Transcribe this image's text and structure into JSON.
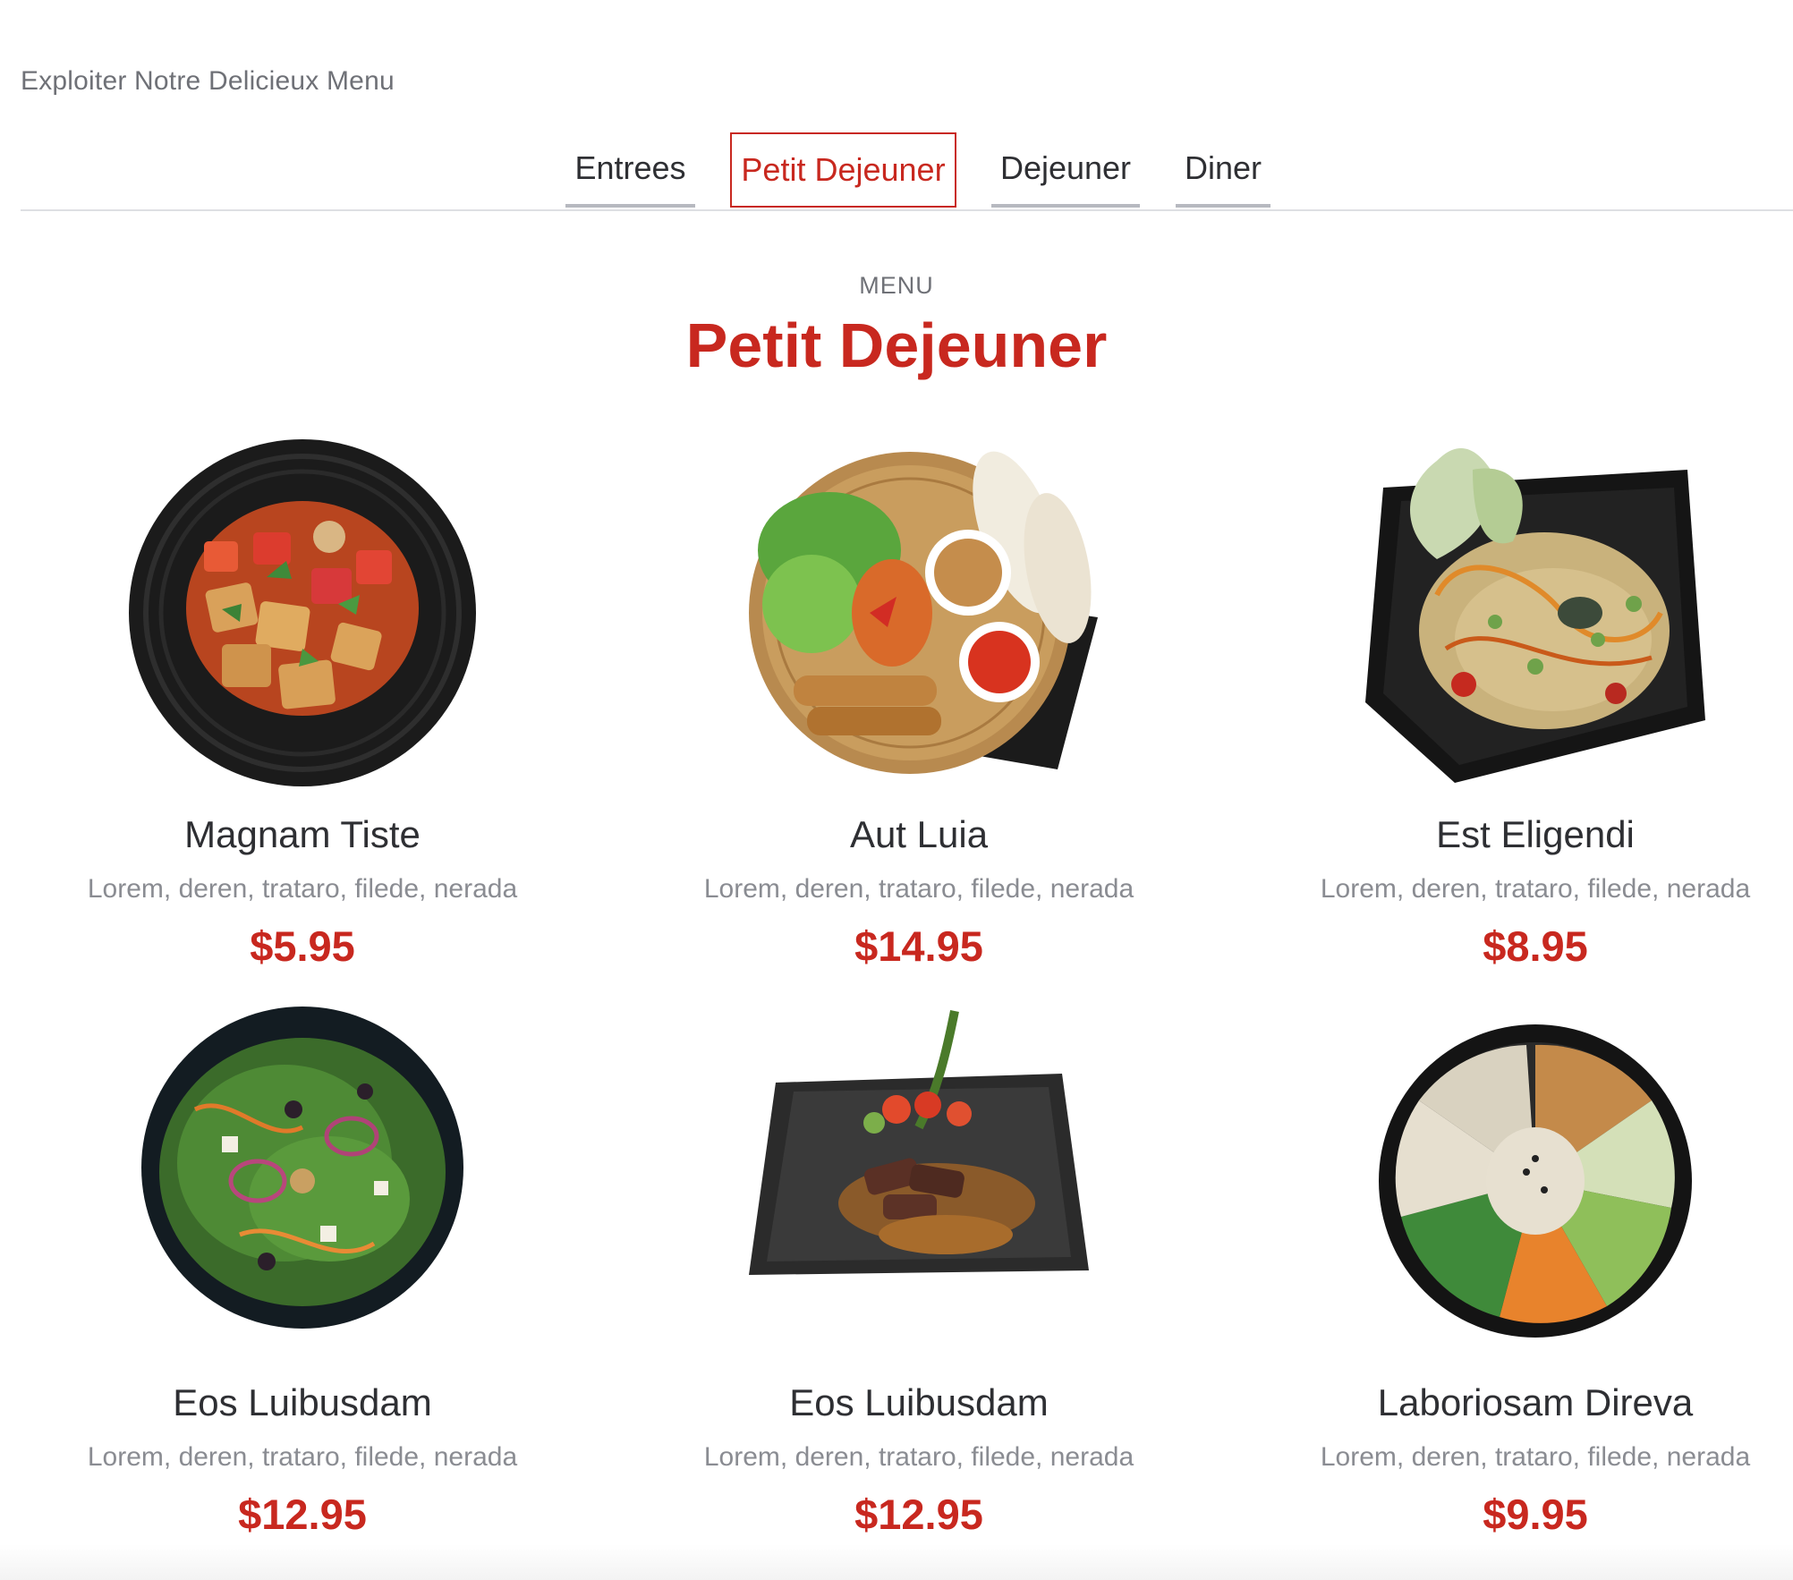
{
  "header": {
    "subtitle": "Exploiter Notre Delicieux Menu"
  },
  "tabs": [
    {
      "label": "Entrees",
      "active": false
    },
    {
      "label": "Petit Dejeuner",
      "active": true
    },
    {
      "label": "Dejeuner",
      "active": false
    },
    {
      "label": "Diner",
      "active": false
    }
  ],
  "section": {
    "eyebrow": "MENU",
    "title": "Petit Dejeuner"
  },
  "items": [
    {
      "name": "Magnam Tiste",
      "description": "Lorem, deren, trataro, filede, nerada",
      "price": "$5.95",
      "image": "tofu-bowl"
    },
    {
      "name": "Aut Luia",
      "description": "Lorem, deren, trataro, filede, nerada",
      "price": "$14.95",
      "image": "spring-roll-basket"
    },
    {
      "name": "Est Eligendi",
      "description": "Lorem, deren, trataro, filede, nerada",
      "price": "$8.95",
      "image": "papaya-salad-plate"
    },
    {
      "name": "Eos Luibusdam",
      "description": "Lorem, deren, trataro, filede, nerada",
      "price": "$12.95",
      "image": "green-salad-bowl"
    },
    {
      "name": "Eos Luibusdam",
      "description": "Lorem, deren, trataro, filede, nerada",
      "price": "$12.95",
      "image": "beef-slate-plate"
    },
    {
      "name": "Laboriosam Direva",
      "description": "Lorem, deren, trataro, filede, nerada",
      "price": "$9.95",
      "image": "poke-bowl"
    }
  ],
  "colors": {
    "accent": "#c8281f",
    "text": "#2e2f33",
    "muted": "#8a8c92"
  }
}
